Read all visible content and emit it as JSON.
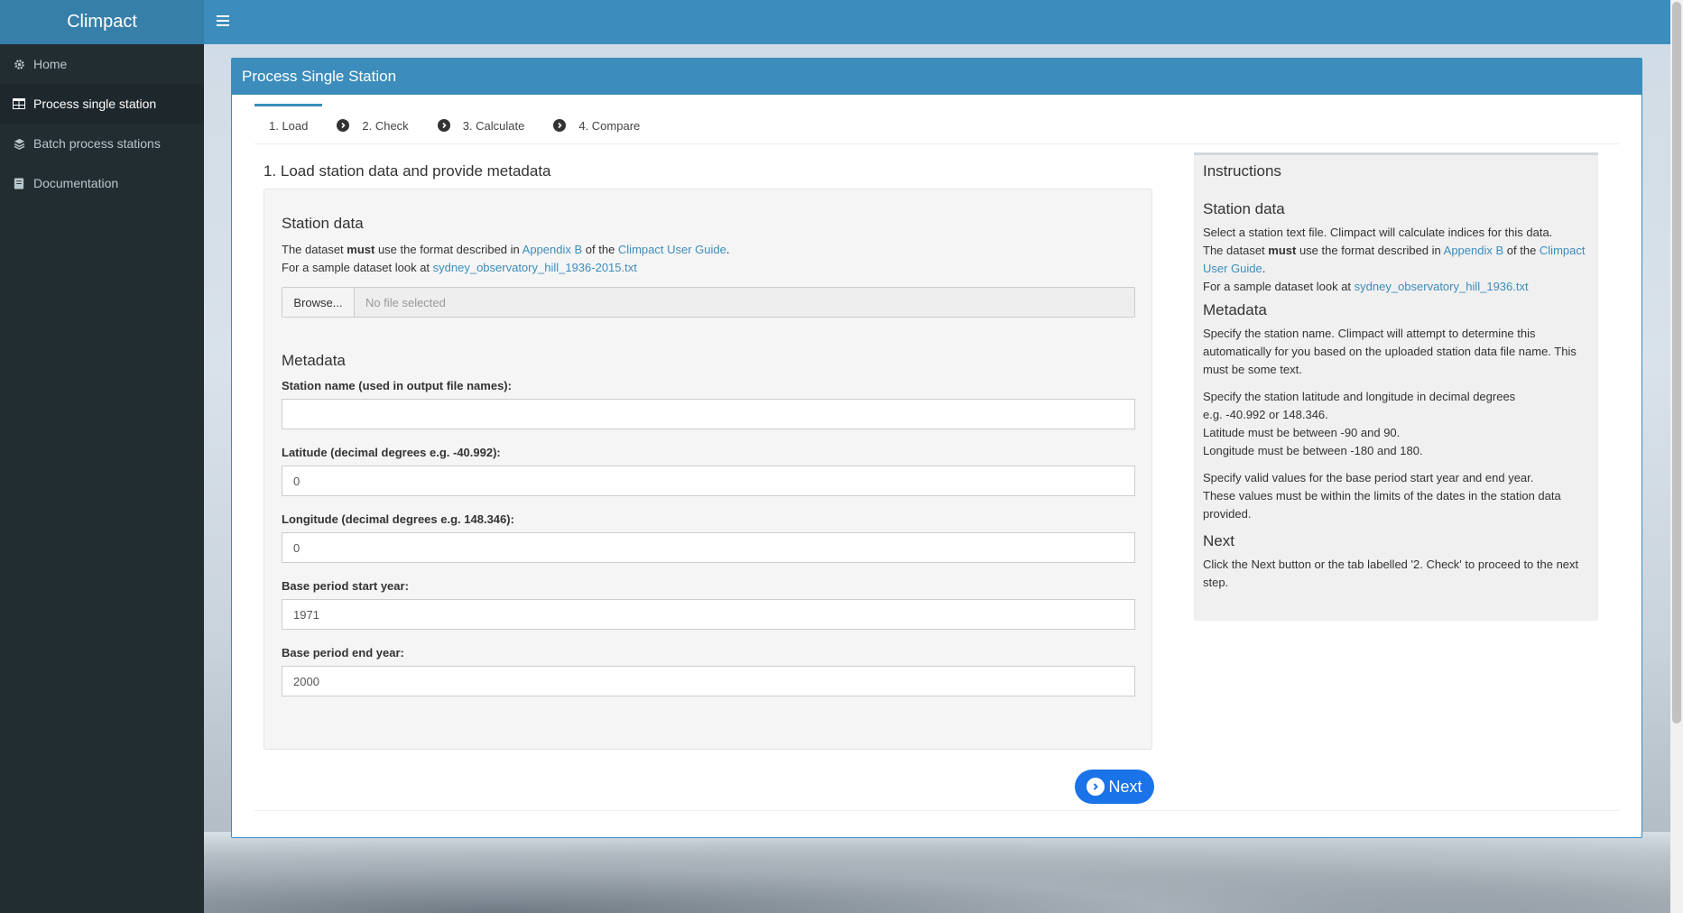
{
  "app": {
    "brand": "Climpact"
  },
  "sidebar": {
    "items": [
      {
        "label": "Home",
        "icon": "gear-icon"
      },
      {
        "label": "Process single station",
        "icon": "table-icon",
        "active": true
      },
      {
        "label": "Batch process stations",
        "icon": "layers-icon"
      },
      {
        "label": "Documentation",
        "icon": "book-icon"
      }
    ]
  },
  "box": {
    "title": "Process Single Station"
  },
  "tabs": [
    {
      "label": "1. Load",
      "active": true
    },
    {
      "label": "2. Check"
    },
    {
      "label": "3. Calculate"
    },
    {
      "label": "4. Compare"
    }
  ],
  "main": {
    "heading": "1. Load station data and provide metadata",
    "station": {
      "title": "Station data",
      "line1_pre": "The dataset ",
      "line1_must": "must",
      "line1_mid": " use the format described in ",
      "line1_link1": "Appendix B",
      "line1_mid2": " of the ",
      "line1_link2": "Climpact User Guide",
      "line1_end": ".",
      "line2_pre": "For a sample dataset look at ",
      "line2_link": "sydney_observatory_hill_1936-2015.txt",
      "browse_label": "Browse...",
      "file_placeholder": "No file selected"
    },
    "metadata": {
      "title": "Metadata",
      "station_name_label": "Station name (used in output file names):",
      "station_name_value": "",
      "lat_label": "Latitude (decimal degrees e.g. -40.992):",
      "lat_value": "0",
      "lon_label": "Longitude (decimal degrees e.g. 148.346):",
      "lon_value": "0",
      "start_label": "Base period start year:",
      "start_value": "1971",
      "end_label": "Base period end year:",
      "end_value": "2000"
    },
    "next_label": "Next"
  },
  "instructions": {
    "title": "Instructions",
    "station_head": "Station data",
    "station_p1": "Select a station text file. Climpact will calculate indices for this data.",
    "station_p2_pre": "The dataset ",
    "station_p2_must": "must",
    "station_p2_mid": " use the format described in ",
    "station_p2_link1": "Appendix B",
    "station_p2_mid2": " of the ",
    "station_p2_link2": "Climpact User Guide",
    "station_p2_end": ".",
    "station_p3_pre": "For a sample dataset look at ",
    "station_p3_link": "sydney_observatory_hill_1936.txt",
    "meta_head": "Metadata",
    "meta_p1": "Specify the station name. Climpact will attempt to determine this automatically for you based on the uploaded station data file name. This must be some text.",
    "meta_p2a": "Specify the station latitude and longitude in decimal degrees",
    "meta_p2b": "e.g. -40.992 or 148.346.",
    "meta_p2c": "Latitude must be between -90 and 90.",
    "meta_p2d": "Longitude must be between -180 and 180.",
    "meta_p3a": "Specify valid values for the base period start year and end year.",
    "meta_p3b": "These values must be within the limits of the dates in the station data provided.",
    "next_head": "Next",
    "next_p": "Click the Next button or the tab labelled '2. Check' to proceed to the next step."
  }
}
